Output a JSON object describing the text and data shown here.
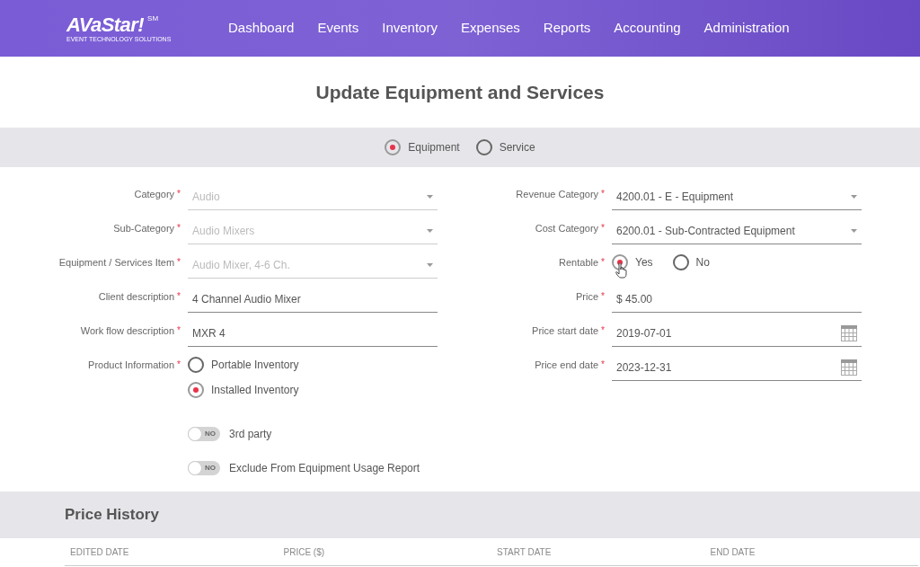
{
  "header": {
    "logo": {
      "name": "AVaStar!",
      "mark": "SM",
      "tagline": "EVENT TECHNOLOGY SOLUTIONS"
    },
    "nav": [
      {
        "label": "Dashboard"
      },
      {
        "label": "Events"
      },
      {
        "label": "Inventory"
      },
      {
        "label": "Expenses"
      },
      {
        "label": "Reports"
      },
      {
        "label": "Accounting"
      },
      {
        "label": "Administration"
      }
    ]
  },
  "page_title": "Update Equipment and Services",
  "type_options": [
    {
      "label": "Equipment",
      "selected": true
    },
    {
      "label": "Service",
      "selected": false
    }
  ],
  "left_fields": [
    {
      "kind": "select",
      "label": "Category",
      "required_mark": "*",
      "value": "Audio",
      "disabled": true
    },
    {
      "kind": "select",
      "label": "Sub-Category",
      "required_mark": "*",
      "value": "Audio Mixers",
      "disabled": true
    },
    {
      "kind": "select",
      "label": "Equipment / Services Item",
      "required_mark": "*",
      "value": "Audio Mixer, 4-6 Ch.",
      "disabled": true
    },
    {
      "kind": "text",
      "label": "Client description",
      "required_mark": "*",
      "value": "4 Channel Audio Mixer",
      "disabled": false
    },
    {
      "kind": "text",
      "label": "Work flow description",
      "required_mark": "*",
      "value": "MXR 4",
      "disabled": false
    },
    {
      "kind": "radios",
      "label": "Product Information",
      "required_mark": "*",
      "options": [
        {
          "label": "Portable Inventory",
          "selected": false
        },
        {
          "label": "Installed Inventory",
          "selected": true
        }
      ]
    },
    {
      "kind": "toggle",
      "label": "3rd party",
      "on": false,
      "state_text": "NO"
    },
    {
      "kind": "toggle",
      "label": "Exclude From Equipment Usage Report",
      "on": false,
      "state_text": "NO"
    }
  ],
  "right_fields": [
    {
      "kind": "select",
      "label": "Revenue Category",
      "required_mark": "*",
      "value": "4200.01 - E - Equipment",
      "disabled": false
    },
    {
      "kind": "select",
      "label": "Cost Category",
      "required_mark": "*",
      "value": "6200.01 - Sub-Contracted Equipment",
      "disabled": false
    },
    {
      "kind": "inline_radios",
      "label": "Rentable",
      "required_mark": "*",
      "options": [
        {
          "label": "Yes",
          "selected": true
        },
        {
          "label": "No",
          "selected": false
        }
      ]
    },
    {
      "kind": "text",
      "label": "Price",
      "required_mark": "*",
      "value": "$ 45.00",
      "disabled": false
    },
    {
      "kind": "date",
      "label": "Price start date",
      "required_mark": "*",
      "value": "2019-07-01",
      "disabled": false
    },
    {
      "kind": "date",
      "label": "Price end date",
      "required_mark": "*",
      "value": "2023-12-31",
      "disabled": false
    }
  ],
  "price_history": {
    "title": "Price History",
    "columns": [
      "EDITED DATE",
      "PRICE ($)",
      "START DATE",
      "END DATE"
    ]
  }
}
